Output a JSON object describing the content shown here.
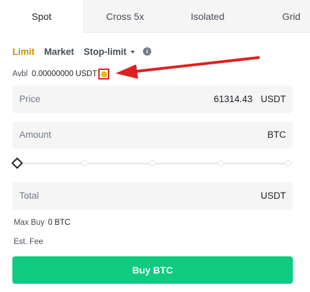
{
  "tabs": [
    {
      "label": "Spot"
    },
    {
      "label": "Cross 5x"
    },
    {
      "label": "Isolated"
    },
    {
      "label": "Grid"
    }
  ],
  "order_types": {
    "limit": "Limit",
    "market": "Market",
    "stop_limit": "Stop-limit",
    "info_icon": "i"
  },
  "available": {
    "label": "Avbl",
    "value": "0.00000000",
    "unit": "USDT"
  },
  "price": {
    "label": "Price",
    "value": "61314.43",
    "unit": "USDT"
  },
  "amount": {
    "label": "Amount",
    "unit": "BTC"
  },
  "slider": {
    "level": 0
  },
  "total": {
    "label": "Total",
    "unit": "USDT"
  },
  "max_buy": {
    "label": "Max Buy",
    "value": "0 BTC"
  },
  "est_fee": {
    "label": "Est. Fee"
  },
  "buy_button": {
    "label": "Buy BTC"
  },
  "colors": {
    "accent": "#c99400",
    "buy": "#0ecb81",
    "annotation": "#e02020"
  }
}
